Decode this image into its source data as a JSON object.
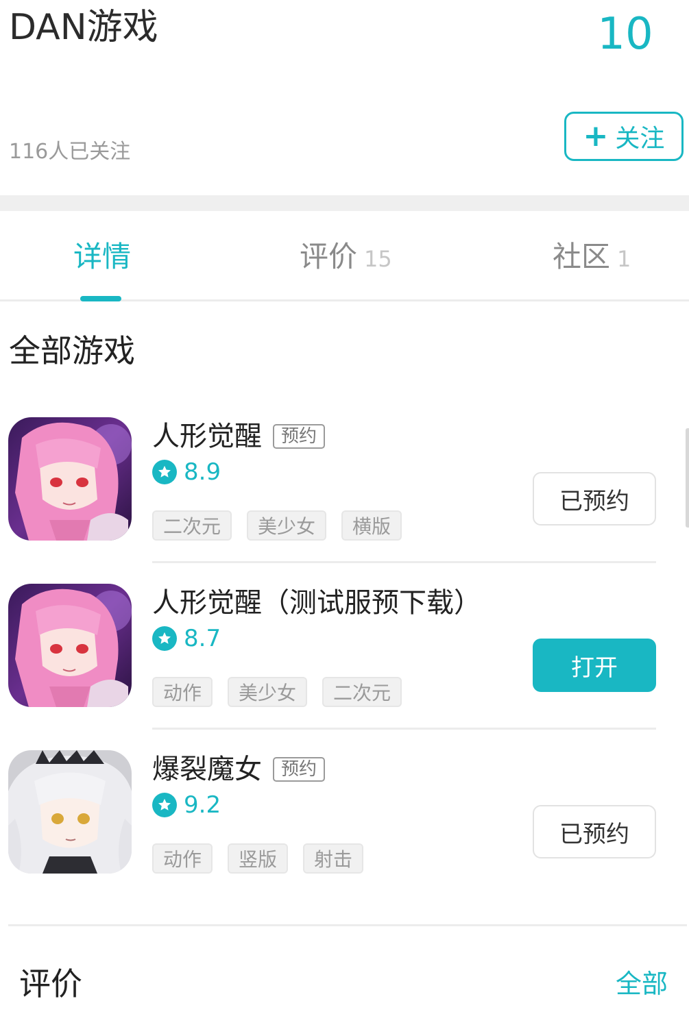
{
  "header": {
    "developer_name": "DAN游戏",
    "score": "10",
    "followers": "116人已关注",
    "follow_button": "关注"
  },
  "tabs": [
    {
      "label": "详情",
      "count": "",
      "active": true
    },
    {
      "label": "评价",
      "count": "15",
      "active": false
    },
    {
      "label": "社区",
      "count": "1",
      "active": false
    }
  ],
  "games_section": {
    "title": "全部游戏",
    "games": [
      {
        "name": "人形觉醒",
        "badge": "预约",
        "rating": "8.9",
        "tags": [
          "二次元",
          "美少女",
          "横版"
        ],
        "action": "已预约",
        "action_style": "outline",
        "icon": "pink-hair-anime-girl-icon"
      },
      {
        "name": "人形觉醒（测试服预下载）",
        "badge": "",
        "rating": "8.7",
        "tags": [
          "动作",
          "美少女",
          "二次元"
        ],
        "action": "打开",
        "action_style": "filled",
        "icon": "pink-hair-anime-girl-icon"
      },
      {
        "name": "爆裂魔女",
        "badge": "预约",
        "rating": "9.2",
        "tags": [
          "动作",
          "竖版",
          "射击"
        ],
        "action": "已预约",
        "action_style": "outline",
        "icon": "silver-hair-witch-icon"
      }
    ]
  },
  "reviews_section": {
    "title": "评价",
    "all_link": "全部"
  },
  "colors": {
    "accent": "#19b7c3",
    "muted_text": "#9a9a9a",
    "divider": "#ececec"
  }
}
